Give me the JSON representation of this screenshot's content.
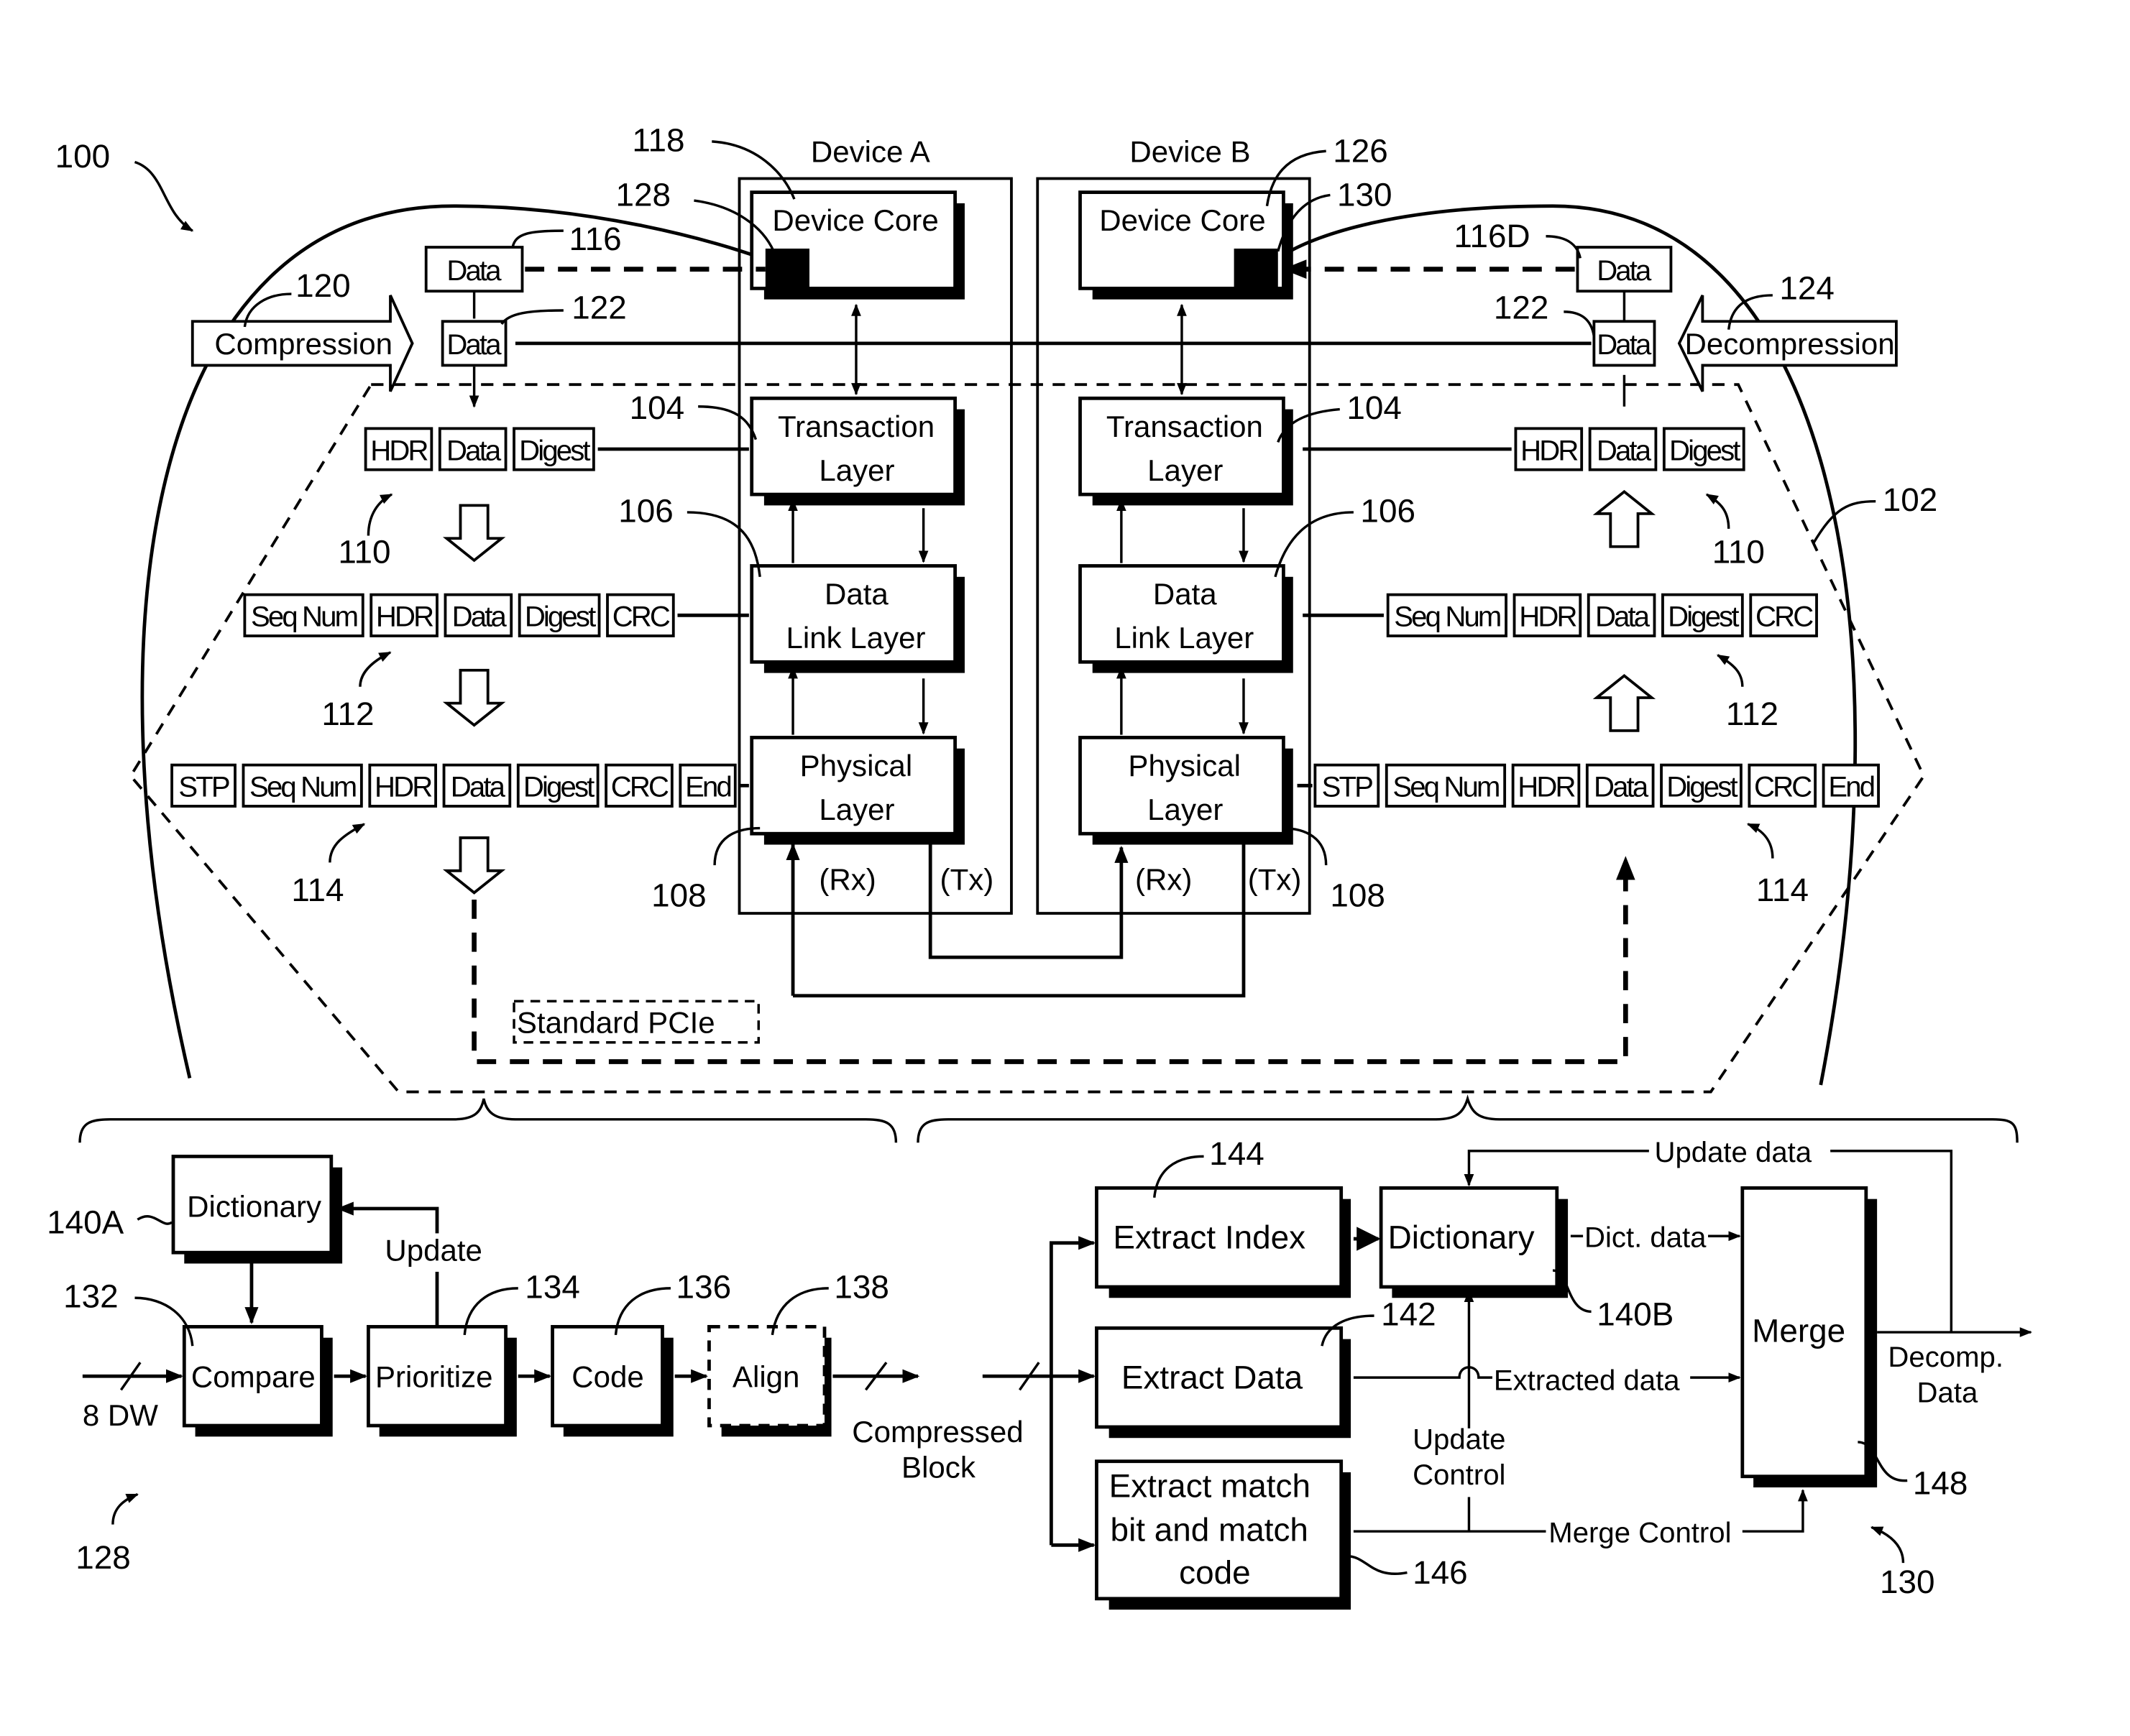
{
  "figure": {
    "ref_main": "100",
    "ref_pcie_region": "102",
    "devices": [
      {
        "title": "Device A",
        "core_label": "Device Core",
        "core_ref": "118",
        "compressor_ref": "128"
      },
      {
        "title": "Device B",
        "core_label": "Device Core",
        "core_ref": "126",
        "decompressor_ref": "130"
      }
    ],
    "layers": {
      "transaction": {
        "line1": "Transaction",
        "line2": "Layer",
        "ref": "104"
      },
      "data_link": {
        "line1": "Data",
        "line2": "Link Layer",
        "ref": "106"
      },
      "physical": {
        "line1": "Physical",
        "line2": "Layer",
        "ref": "108"
      },
      "rx": "(Rx)",
      "tx": "(Tx)"
    },
    "left_side": {
      "data_raw": {
        "label": "Data",
        "ref": "116"
      },
      "data_compressed": {
        "label": "Data",
        "ref": "122"
      },
      "arrow": {
        "label": "Compression",
        "ref": "120"
      }
    },
    "right_side": {
      "data_raw": {
        "label": "Data",
        "ref": "116D"
      },
      "data_compressed": {
        "label": "Data",
        "ref": "122"
      },
      "arrow": {
        "label": "Decompression",
        "ref": "124"
      }
    },
    "packets": {
      "tlp": {
        "fields": [
          "HDR",
          "Data",
          "Digest"
        ],
        "ref": "110"
      },
      "dllp": {
        "fields": [
          "Seq Num",
          "HDR",
          "Data",
          "Digest",
          "CRC"
        ],
        "ref": "112"
      },
      "phy": {
        "fields": [
          "STP",
          "Seq Num",
          "HDR",
          "Data",
          "Digest",
          "CRC",
          "End"
        ],
        "ref": "114"
      }
    },
    "standard_pcie_label": "Standard PCIe"
  },
  "compressor": {
    "ref": "128",
    "input_label": "8 DW",
    "dictionary": {
      "label": "Dictionary",
      "ref": "140A"
    },
    "update_label": "Update",
    "blocks": [
      {
        "label": "Compare",
        "ref": "132"
      },
      {
        "label": "Prioritize",
        "ref": "134"
      },
      {
        "label": "Code",
        "ref": "136"
      },
      {
        "label": "Align",
        "ref": "138",
        "optional": true
      }
    ],
    "output_label_line1": "Compressed",
    "output_label_line2": "Block"
  },
  "decompressor": {
    "ref": "130",
    "extract_index": {
      "label": "Extract Index",
      "ref": "144"
    },
    "extract_data": {
      "label": "Extract Data",
      "ref": "142"
    },
    "extract_match": {
      "line1": "Extract match",
      "line2": "bit and match",
      "line3": "code",
      "ref": "146"
    },
    "dictionary": {
      "label": "Dictionary",
      "ref": "140B"
    },
    "merge": {
      "label": "Merge",
      "ref": "148"
    },
    "signals": {
      "update_data": "Update data",
      "dict_data": "Dict. data",
      "extracted_data": "Extracted data",
      "update_control_line1": "Update",
      "update_control_line2": "Control",
      "merge_control": "Merge Control",
      "output_line1": "Decomp.",
      "output_line2": "Data"
    }
  }
}
